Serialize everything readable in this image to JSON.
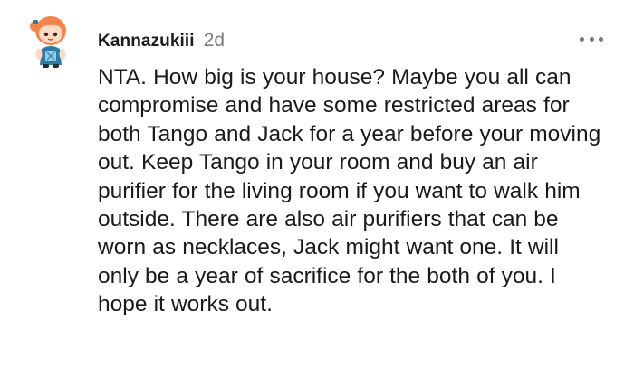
{
  "comment": {
    "username": "Kannazukiii",
    "timestamp": "2d",
    "body": "NTA. How big is your house? Maybe you all can compromise and have some restricted areas for both Tango and Jack for a year before your moving out. Keep Tango in your room and buy an air purifier for the living room if you want to walk him outside. There are also air purifiers that can be worn as necklaces, Jack might want one. It will only be a year of sacrifice for the both of you. I hope it works out.",
    "avatar_icon": "snoo-avatar-icon",
    "more_icon": "more-options-icon"
  },
  "colors": {
    "avatar_hair": "#f2864a",
    "avatar_skin": "#ffd9c4",
    "avatar_outfit": "#2f7aa3",
    "avatar_outfit_accent": "#8fd0e8",
    "timestamp": "#7c7c7c"
  }
}
